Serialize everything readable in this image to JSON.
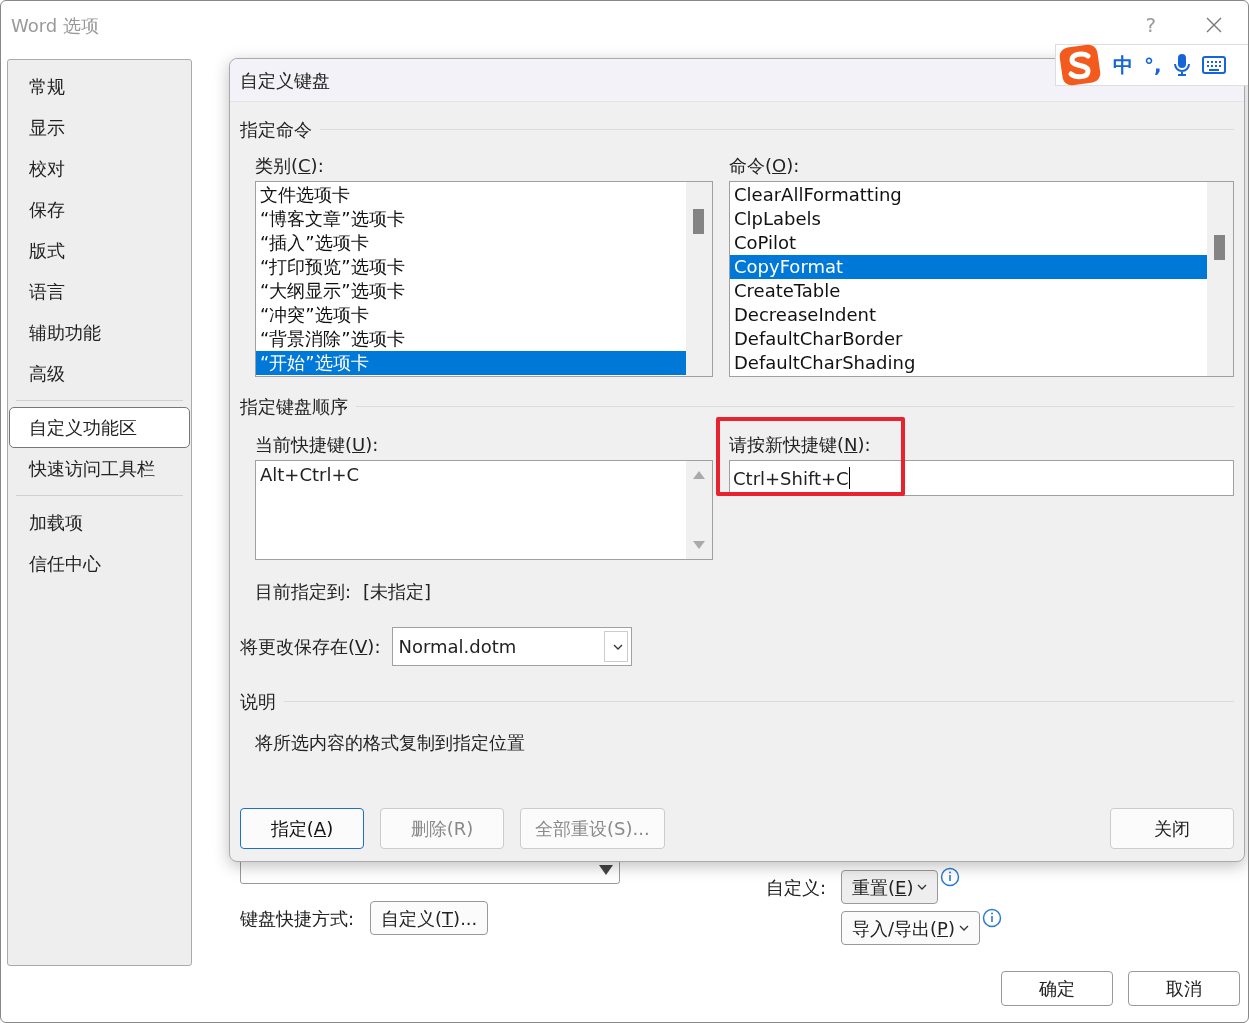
{
  "window": {
    "title": "Word 选项",
    "help": "?"
  },
  "sidebar": {
    "items": [
      {
        "label": "常规",
        "selected": false,
        "divider_after": false
      },
      {
        "label": "显示",
        "selected": false,
        "divider_after": false
      },
      {
        "label": "校对",
        "selected": false,
        "divider_after": false
      },
      {
        "label": "保存",
        "selected": false,
        "divider_after": false
      },
      {
        "label": "版式",
        "selected": false,
        "divider_after": false
      },
      {
        "label": "语言",
        "selected": false,
        "divider_after": false
      },
      {
        "label": "辅助功能",
        "selected": false,
        "divider_after": false
      },
      {
        "label": "高级",
        "selected": false,
        "divider_after": true
      },
      {
        "label": "自定义功能区",
        "selected": true,
        "divider_after": false
      },
      {
        "label": "快速访问工具栏",
        "selected": false,
        "divider_after": true
      },
      {
        "label": "加载项",
        "selected": false,
        "divider_after": false
      },
      {
        "label": "信任中心",
        "selected": false,
        "divider_after": false
      }
    ]
  },
  "background": {
    "customize_label": "自定义:",
    "reset_button": {
      "label": "重置(",
      "access_key": "E",
      "label_after": ")"
    },
    "import_export_button": {
      "label": "导入/导出(",
      "access_key": "P",
      "label_after": ")"
    },
    "keyboard_label": "键盘快捷方式:",
    "customize_button": {
      "label": "自定义(",
      "access_key": "T",
      "label_after": ")..."
    },
    "ok_button": "确定",
    "cancel_button": "取消"
  },
  "ime_toolbar": {
    "mode": "中",
    "punctuation": "°,"
  },
  "dialog": {
    "title": "自定义键盘",
    "assign_section": "指定命令",
    "categories": {
      "label": "类别(",
      "access_key": "C",
      "label_after": "):",
      "items": [
        {
          "label": "文件选项卡",
          "selected": false
        },
        {
          "label": "“博客文章”选项卡",
          "selected": false
        },
        {
          "label": "“插入”选项卡",
          "selected": false
        },
        {
          "label": "“打印预览”选项卡",
          "selected": false
        },
        {
          "label": "“大纲显示”选项卡",
          "selected": false
        },
        {
          "label": "“冲突”选项卡",
          "selected": false
        },
        {
          "label": "“背景消除”选项卡",
          "selected": false
        },
        {
          "label": "“开始”选项卡",
          "selected": true
        }
      ]
    },
    "commands": {
      "label": "命令(",
      "access_key": "O",
      "label_after": "):",
      "items": [
        {
          "label": "ClearAllFormatting",
          "selected": false
        },
        {
          "label": "ClpLabels",
          "selected": false
        },
        {
          "label": "CoPilot",
          "selected": false
        },
        {
          "label": "CopyFormat",
          "selected": true
        },
        {
          "label": "CreateTable",
          "selected": false
        },
        {
          "label": "DecreaseIndent",
          "selected": false
        },
        {
          "label": "DefaultCharBorder",
          "selected": false
        },
        {
          "label": "DefaultCharShading",
          "selected": false
        }
      ]
    },
    "sequence_section": "指定键盘顺序",
    "current_keys": {
      "label": "当前快捷键(",
      "access_key": "U",
      "label_after": "):",
      "items": [
        "Alt+Ctrl+C"
      ]
    },
    "new_key": {
      "label": "请按新快捷键(",
      "access_key": "N",
      "label_after": "):",
      "value": "Ctrl+Shift+C",
      "highlighted": true
    },
    "assigned_to": {
      "label": "目前指定到:",
      "value": "[未指定]"
    },
    "save_in": {
      "label": "将更改保存在(",
      "access_key": "V",
      "label_after": "):",
      "value": "Normal.dotm"
    },
    "description_section": "说明",
    "description": "将所选内容的格式复制到指定位置",
    "buttons": [
      {
        "label": "指定(",
        "access_key": "A",
        "label_after": ")",
        "disabled": false,
        "default": true
      },
      {
        "label": "删除(R)",
        "disabled": true,
        "default": false
      },
      {
        "label": "全部重设(S)...",
        "disabled": true,
        "default": false
      }
    ],
    "close_button": "关闭"
  }
}
